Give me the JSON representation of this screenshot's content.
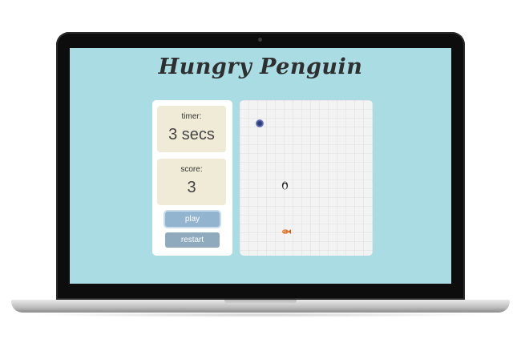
{
  "game": {
    "title": "Hungry Penguin"
  },
  "stats": {
    "timer_label": "timer:",
    "timer_value": "3 secs",
    "score_label": "score:",
    "score_value": "3"
  },
  "controls": {
    "play_label": "play",
    "restart_label": "restart"
  },
  "board": {
    "pieces": [
      "hole-icon",
      "penguin-icon",
      "fish-icon"
    ]
  },
  "colors": {
    "screen_bg": "#a9dce3",
    "stat_box_bg": "#efebd6",
    "play_button": "#93b4cf",
    "restart_button": "#8fa9bd",
    "title_text": "#2f2f2f"
  }
}
